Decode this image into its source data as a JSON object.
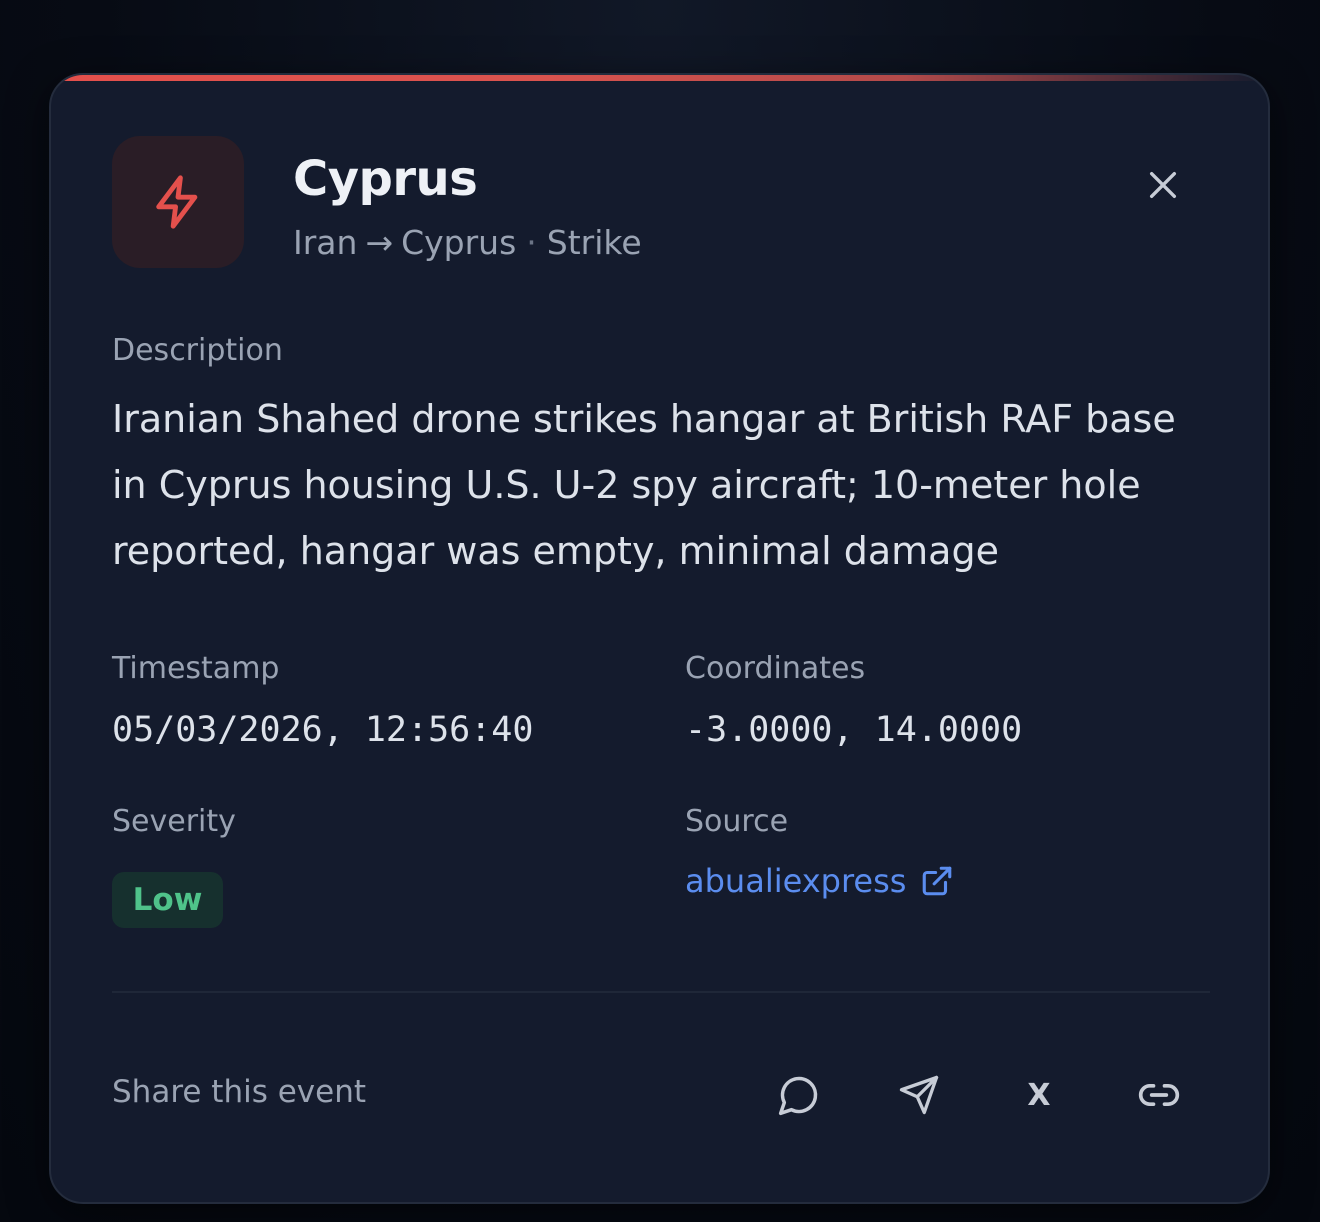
{
  "event": {
    "title": "Cyprus",
    "origin": "Iran",
    "arrow": "→",
    "target": "Cyprus",
    "separator": "·",
    "type": "Strike",
    "icon": "lightning-bolt-icon",
    "accent_color": "#e4504c"
  },
  "description": {
    "label": "Description",
    "text": "Iranian Shahed drone strikes hangar at British RAF base in Cyprus housing U.S. U-2 spy aircraft; 10-meter hole reported, hangar was empty, minimal damage"
  },
  "timestamp": {
    "label": "Timestamp",
    "value": "05/03/2026, 12:56:40"
  },
  "coordinates": {
    "label": "Coordinates",
    "value": "-3.0000, 14.0000"
  },
  "severity": {
    "label": "Severity",
    "value": "Low",
    "color": "#4fc38a"
  },
  "source": {
    "label": "Source",
    "value": "abualiexpress",
    "icon": "external-link-icon",
    "color": "#5b8def"
  },
  "share": {
    "label": "Share this event",
    "buttons": [
      {
        "icon": "whatsapp-chat-icon"
      },
      {
        "icon": "telegram-send-icon"
      },
      {
        "icon": "x-icon",
        "glyph": "X"
      },
      {
        "icon": "copy-link-icon"
      }
    ]
  },
  "close_icon": "close-icon"
}
